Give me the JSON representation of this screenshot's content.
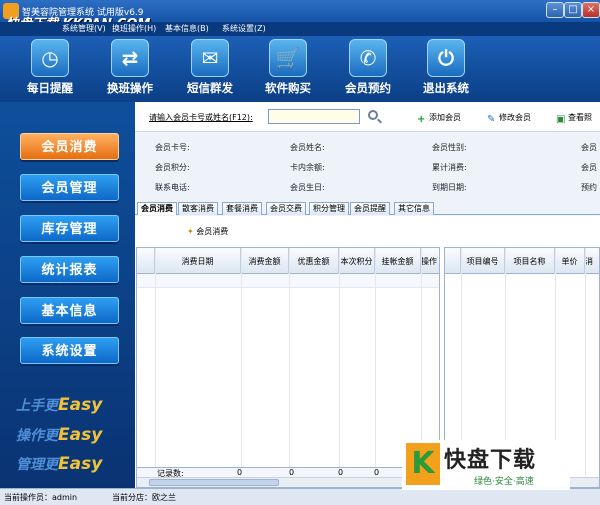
{
  "window": {
    "title": "智美容院管理系统 试用版v6.9",
    "watermark": "快盘下载 KKPAN.COM",
    "min_glyph": "–",
    "max_glyph": "□",
    "close_glyph": "×"
  },
  "menu": {
    "items": [
      "系统管理(V)",
      "换班操作(H)",
      "基本信息(B)",
      "系统设置(Z)"
    ]
  },
  "toolbar": {
    "buttons": [
      {
        "label": "每日提醒",
        "icon": "clock-icon",
        "glyph": "◷"
      },
      {
        "label": "换班操作",
        "icon": "swap-icon",
        "glyph": "⇄"
      },
      {
        "label": "短信群发",
        "icon": "mail-icon",
        "glyph": "✉"
      },
      {
        "label": "软件购买",
        "icon": "cart-icon",
        "glyph": "🛒"
      },
      {
        "label": "会员预约",
        "icon": "phone-icon",
        "glyph": "✆"
      },
      {
        "label": "退出系统",
        "icon": "power-icon",
        "glyph": "⏻"
      }
    ]
  },
  "sidebar": {
    "items": [
      "会员消费",
      "会员管理",
      "库存管理",
      "统计报表",
      "基本信息",
      "系统设置"
    ],
    "active": "会员消费",
    "slogans": [
      {
        "prefix": "上手更",
        "word": "Easy"
      },
      {
        "prefix": "操作更",
        "word": "Easy"
      },
      {
        "prefix": "管理更",
        "word": "Easy"
      }
    ]
  },
  "search": {
    "label": "请输入会员卡号或姓名(F12):",
    "value": ""
  },
  "actions": {
    "add_member": "添加会员",
    "edit_member": "修改会员",
    "view_photo": "查看照"
  },
  "member_info": {
    "card_no": "会员卡号:",
    "name": "会员姓名:",
    "gender": "会员性别:",
    "col4_row1": "会员",
    "points": "会员积分:",
    "balance": "卡内余额:",
    "total_spent": "累计消费:",
    "col4_row2": "会员",
    "phone": "联系电话:",
    "birthday": "会员生日:",
    "expiry": "到期日期:",
    "col4_row3": "预约"
  },
  "tabs": [
    "会员消费",
    "散客消费",
    "套餐消费",
    "会员交费",
    "积分管理",
    "会员提醒",
    "其它信息"
  ],
  "consume_button": "会员消费",
  "left_grid": {
    "columns": [
      "消费日期",
      "消费金额",
      "优惠金额",
      "本次积分",
      "挂帐金额",
      "操作"
    ],
    "footer_label": "记录数:",
    "footer_values": [
      "0",
      "0",
      "0",
      "0",
      "0"
    ]
  },
  "right_grid": {
    "columns": [
      "项目编号",
      "项目名称",
      "单价",
      "消"
    ]
  },
  "status": {
    "operator": "当前操作员：admin",
    "branch": "当前分店：欧之兰"
  },
  "logo": {
    "k": "K",
    "text": "快盘下载",
    "sub": "绿色·安全·高速"
  }
}
